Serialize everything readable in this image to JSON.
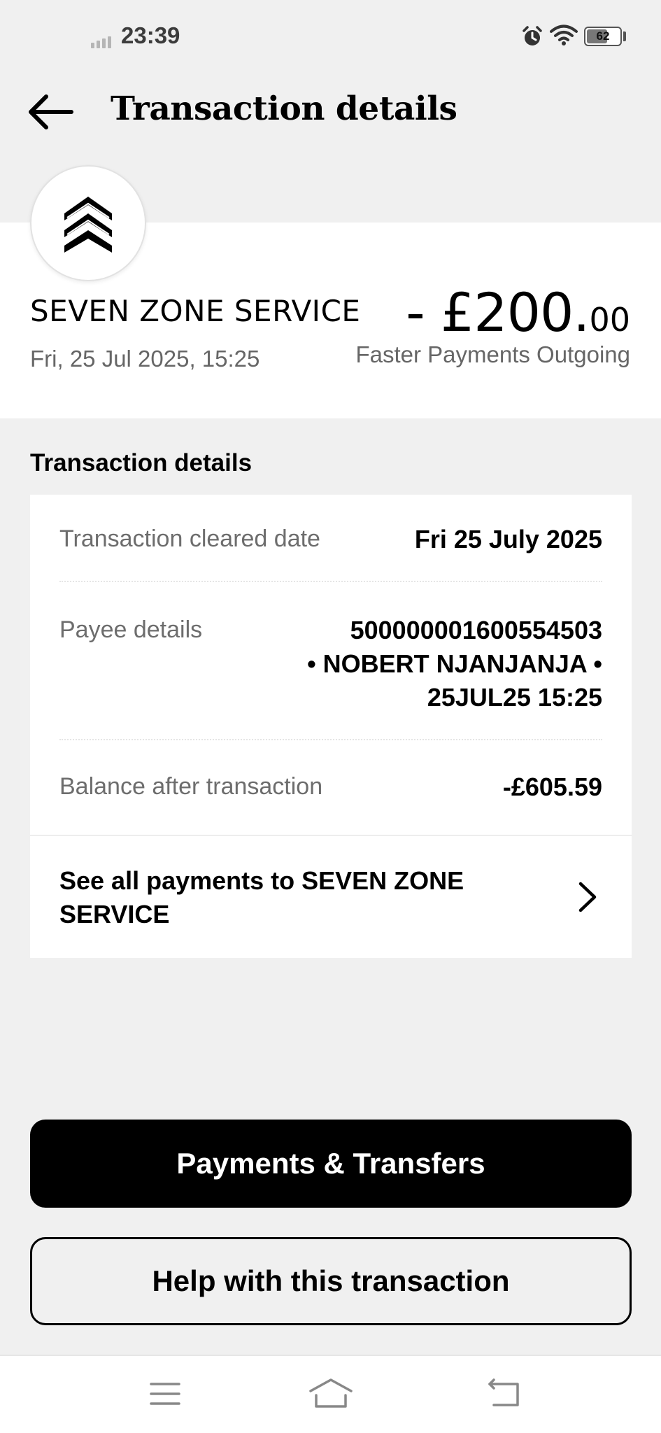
{
  "status_bar": {
    "time": "23:39",
    "battery_level": 62,
    "battery_text": "62",
    "icons": [
      "signal-icon",
      "alarm-icon",
      "wifi-icon",
      "battery-icon"
    ]
  },
  "header": {
    "title": "Transaction details",
    "back_icon": "arrow-left-icon"
  },
  "summary": {
    "merchant_logo_icon": "chevron-stack-icon",
    "merchant_name": "SEVEN ZONE SERVICE",
    "date_time": "Fri, 25 Jul 2025, 15:25",
    "amount_main": "- £200.",
    "amount_pence": "00",
    "transaction_type": "Faster Payments Outgoing"
  },
  "details": {
    "heading": "Transaction details",
    "rows": [
      {
        "label": "Transaction cleared date",
        "value": "Fri 25 July 2025"
      },
      {
        "label": "Payee details",
        "value_lines": [
          "500000001600554503",
          "• NOBERT NJANJANJA •",
          "25JUL25 15:25"
        ]
      },
      {
        "label": "Balance after transaction",
        "value": "-£605.59"
      }
    ],
    "see_all_label": "See all payments to SEVEN ZONE SERVICE"
  },
  "actions": {
    "primary_label": "Payments & Transfers",
    "secondary_label": "Help with this transaction"
  },
  "nav_bar": {
    "icons": [
      "menu-icon",
      "home-icon",
      "back-icon"
    ]
  },
  "colors": {
    "background": "#f0f0f0",
    "card": "#ffffff",
    "primary": "#000000",
    "muted_text": "#6d6d6d"
  }
}
